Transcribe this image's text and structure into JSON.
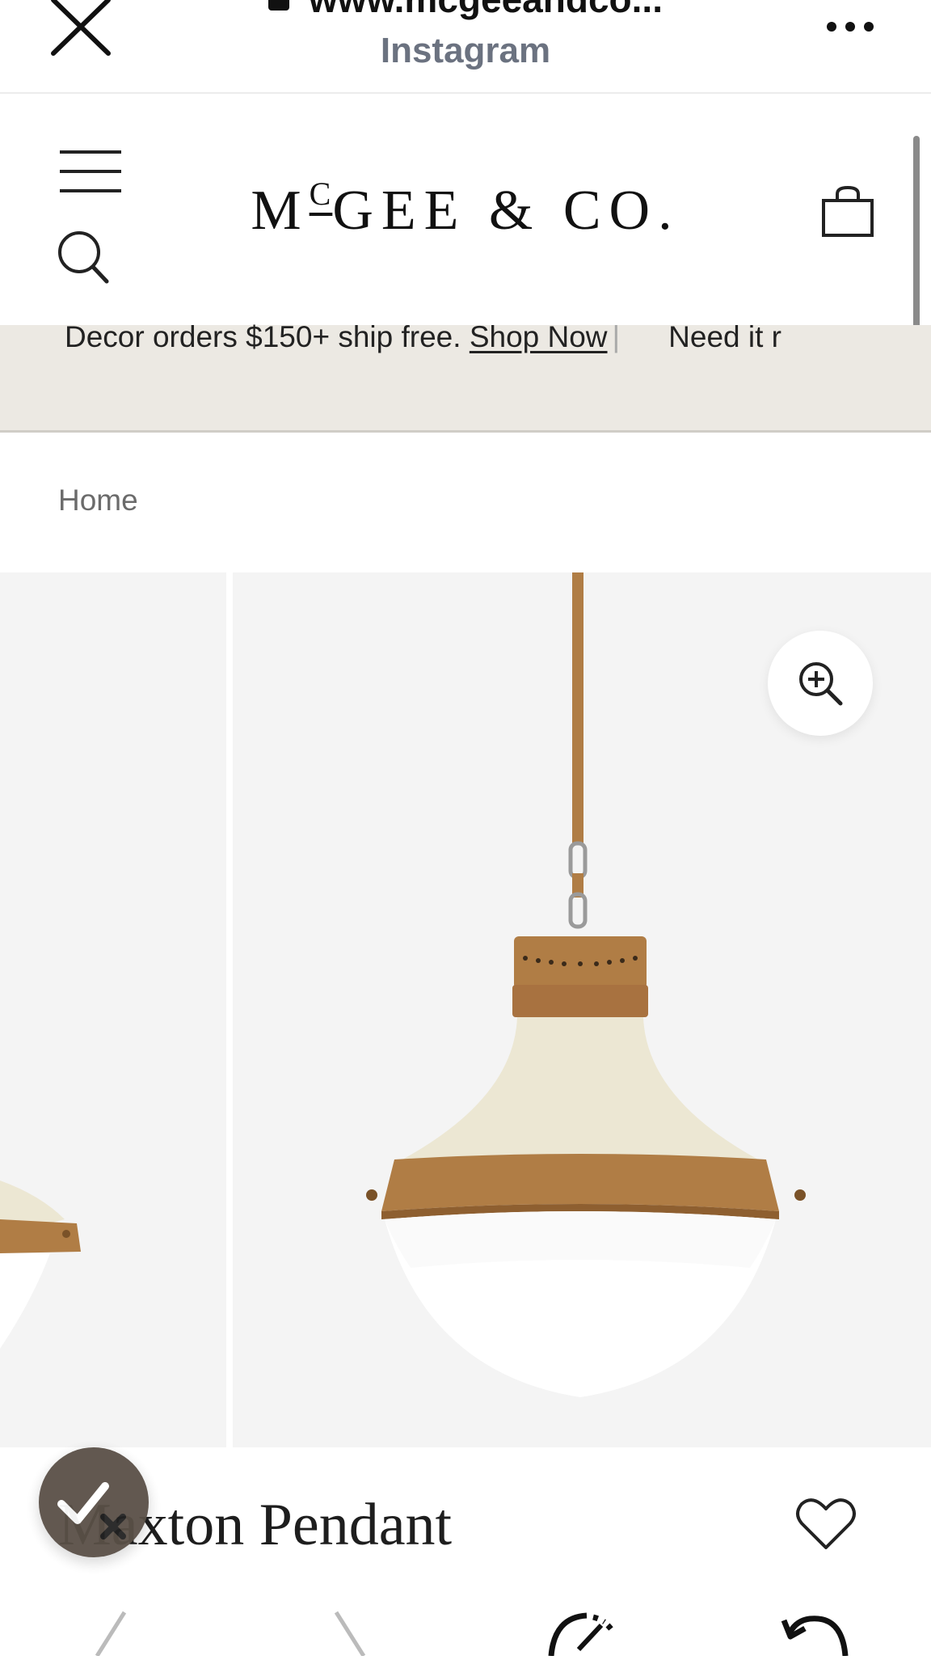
{
  "browser": {
    "url": "www.mcgeeandco...",
    "subtitle": "Instagram",
    "close_icon": "close-icon",
    "more_icon": "more-horizontal-icon"
  },
  "header": {
    "brand_main": "M",
    "brand_c": "C",
    "brand_rest": "GEE & CO.",
    "menu_icon": "hamburger-menu-icon",
    "search_icon": "search-icon",
    "bag_icon": "shopping-bag-icon"
  },
  "promo": {
    "text": "Decor orders $150+ ship free.",
    "link": "Shop Now",
    "separator": "|",
    "next_text": "Need it r"
  },
  "breadcrumb": {
    "home": "Home"
  },
  "product": {
    "title": "Maxton Pendant",
    "zoom_icon": "zoom-in-icon",
    "favorite_icon": "heart-icon"
  },
  "colors": {
    "promo_bg": "#ece9e3",
    "gallery_bg": "#f4f4f4",
    "brass": "#b07d45",
    "cream": "#ece7d3",
    "badge": "#5a5047"
  }
}
